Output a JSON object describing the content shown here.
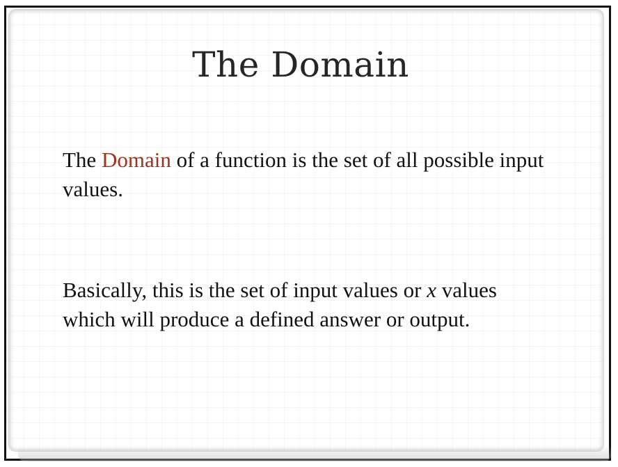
{
  "slide": {
    "title": "The Domain",
    "paragraph1": {
      "before": "The ",
      "highlight": "Domain",
      "after": " of a function is the set of all possible input values."
    },
    "paragraph2": {
      "before": "Basically, this is the set of input values or ",
      "variable": "x",
      "after": " values which will produce a defined answer or output."
    }
  },
  "colors": {
    "highlight": "#9c3420",
    "text": "#111111",
    "title": "#262626"
  }
}
